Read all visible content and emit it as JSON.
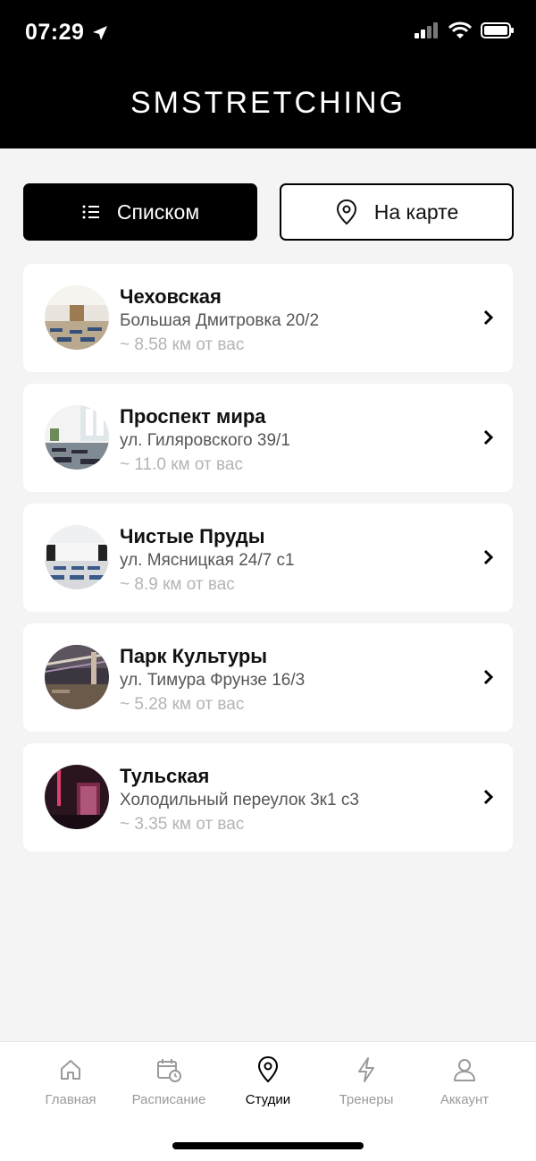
{
  "status_bar": {
    "time": "07:29"
  },
  "header": {
    "brand": "SMSTRETCHING"
  },
  "view_toggle": {
    "list_label": "Списком",
    "map_label": "На карте",
    "active": "list"
  },
  "studios": [
    {
      "name": "Чеховская",
      "address": "Большая Дмитровка 20/2",
      "distance": "~ 8.58 км от вас"
    },
    {
      "name": "Проспект мира",
      "address": "ул. Гиляровского 39/1",
      "distance": "~ 11.0 км от вас"
    },
    {
      "name": "Чистые Пруды",
      "address": "ул. Мясницкая 24/7 с1",
      "distance": "~ 8.9 км от вас"
    },
    {
      "name": "Парк Культуры",
      "address": "ул. Тимура Фрунзе 16/3",
      "distance": "~ 5.28 км от вас"
    },
    {
      "name": "Тульская",
      "address": "Холодильный переулок 3к1 с3",
      "distance": "~ 3.35 км от вас"
    }
  ],
  "tabbar": {
    "items": [
      {
        "label": "Главная",
        "icon": "home-icon"
      },
      {
        "label": "Расписание",
        "icon": "calendar-clock-icon"
      },
      {
        "label": "Студии",
        "icon": "map-pin-icon",
        "active": true
      },
      {
        "label": "Тренеры",
        "icon": "lightning-icon"
      },
      {
        "label": "Аккаунт",
        "icon": "user-icon"
      }
    ]
  },
  "colors": {
    "accent": "#000000",
    "background": "#f4f4f4",
    "muted": "#9a9a9a"
  }
}
